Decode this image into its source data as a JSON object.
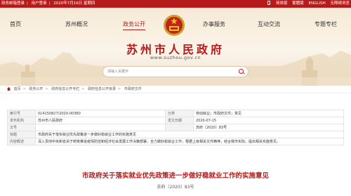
{
  "topbar": {
    "links": [
      "政务邮箱登录",
      "用户登录",
      "2020年7月16日 星期四"
    ],
    "right_links": [
      "简体版",
      "繁體版",
      "ENGLISH",
      "无障碍浏览"
    ]
  },
  "nav": {
    "items": [
      "首页",
      "苏州概况",
      "政务公开",
      "办事服务",
      "互动交流",
      "专题专栏"
    ],
    "active": "政务公开"
  },
  "header": {
    "title": "苏州市人民政府",
    "url": "www.suzhou.gov.cn"
  },
  "search": {
    "placeholder": "请输入关键字"
  },
  "breadcrumb": [
    "首页",
    "政务公开",
    "政府信息公开专栏",
    "政府信息公开目录",
    "市政府文件"
  ],
  "info": {
    "rows": [
      {
        "k1": "索引号",
        "v1": "014150827/2020-00360",
        "k2": "分类",
        "v2": "劳动就业；市政府文件；意见"
      },
      {
        "k1": "发布机构",
        "v1": "苏州市人民政府",
        "k2": "发文日期",
        "v2": "2020-07-15"
      },
      {
        "k1": "文号",
        "v1": "",
        "k2": "",
        "v2": "苏府〔2020〕83号"
      },
      {
        "k1": "标题",
        "v1": "市政府关于落实就业优先政策进一步做好稳就业工作的实施意见",
        "k2": "",
        "v2": ""
      },
      {
        "k1": "内容概述",
        "v1": "深入贯彻中央和省关于统筹推进疫情防控和经济社会发展工作决策部署，全力做好稳就业工作，根据上级相关文件精神，结合我市实际，提出相关实施意见。",
        "k2": "",
        "v2": ""
      }
    ]
  },
  "document": {
    "title": "市政府关于落实就业优先政策进一步做好稳就业工作的实施意见",
    "number": "苏府〔2020〕83号"
  },
  "colors": {
    "accent": "#b51b1b",
    "banner": "#f6ead6"
  },
  "icons": [
    "phone-icon",
    "home-icon",
    "search-icon",
    "national-emblem-icon"
  ]
}
